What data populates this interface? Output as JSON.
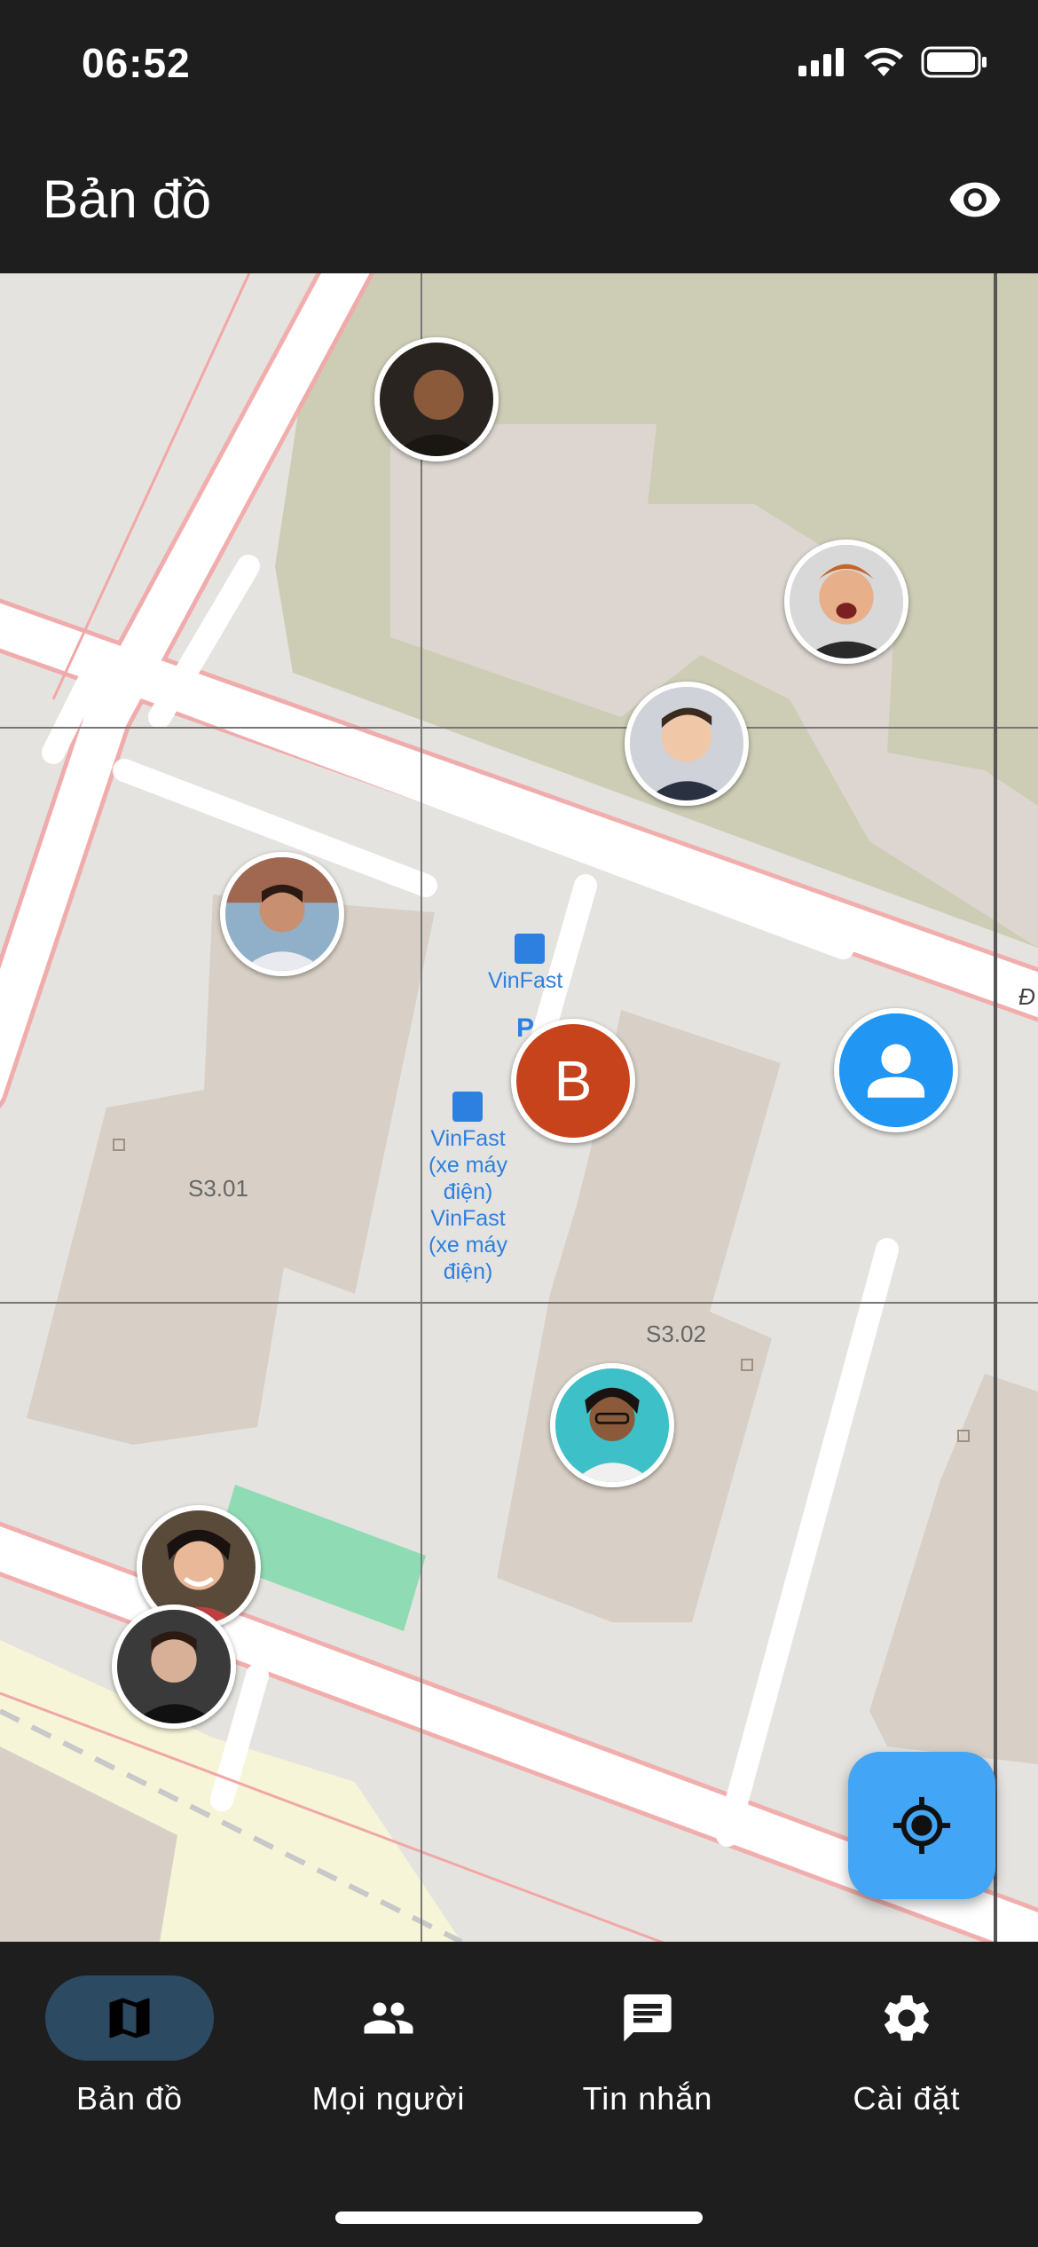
{
  "status_bar": {
    "time": "06:52"
  },
  "app_bar": {
    "title": "Bản đồ",
    "visibility_icon": "eye-icon"
  },
  "map": {
    "building_labels": [
      "S3.01",
      "S3.02"
    ],
    "poi_vinfast": "VinFast",
    "poi_vinfast_motorbike": "VinFast (xe máy điện) VinFast (xe máy điện)",
    "parking_label": "P",
    "street_label_partial": "Đ",
    "current_user_initial": "B",
    "colors": {
      "current_user": "#c6431c",
      "unknown_user": "#2196f3",
      "accent": "#42a5f5"
    }
  },
  "fab": {
    "icon": "my-location-icon"
  },
  "bottom_nav": {
    "items": [
      {
        "label": "Bản đồ",
        "icon": "map-icon",
        "active": true
      },
      {
        "label": "Mọi người",
        "icon": "people-icon",
        "active": false
      },
      {
        "label": "Tin nhắn",
        "icon": "message-icon",
        "active": false
      },
      {
        "label": "Cài đặt",
        "icon": "settings-icon",
        "active": false
      }
    ]
  }
}
